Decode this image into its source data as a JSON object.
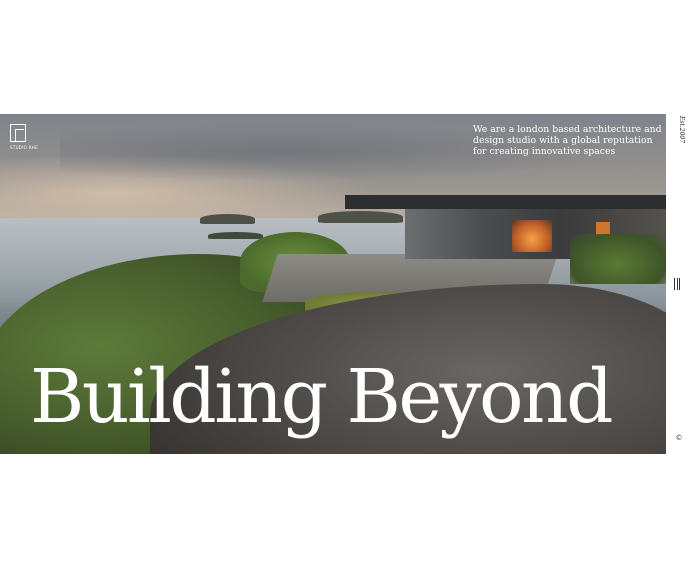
{
  "brand": {
    "logo_text": "STUDIO RHE"
  },
  "hero": {
    "tagline": "We are a london based architecture and design studio with a global reputation for creating innovative spaces",
    "headline": "Building Beyond",
    "image_alt": "Hillside house overlooking the sea at dusk"
  },
  "rail": {
    "established": "Est.2007",
    "menu_icon": "menu-icon",
    "scroll_marker": "©"
  }
}
